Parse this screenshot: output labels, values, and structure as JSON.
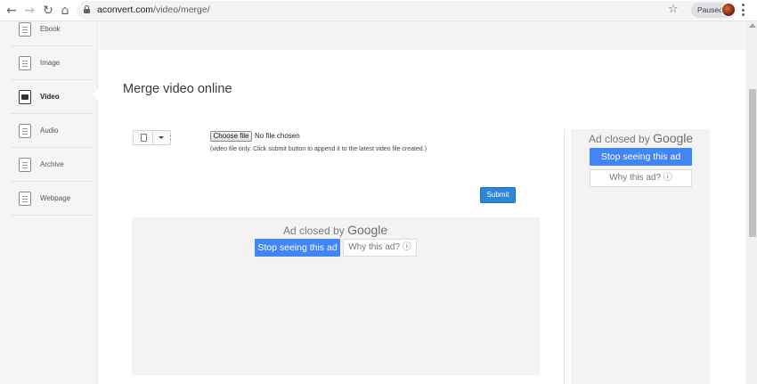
{
  "browser": {
    "url_domain": "aconvert.com",
    "url_path": "/video/merge/",
    "profile_status": "Paused",
    "icons": [
      "back-arrow-icon",
      "forward-arrow-icon",
      "reload-icon",
      "home-icon",
      "lock-icon",
      "star-icon",
      "menu-dots-icon"
    ]
  },
  "sidebar": {
    "items": [
      {
        "label": "Ebook",
        "icon": "ebook-icon"
      },
      {
        "label": "Image",
        "icon": "image-icon"
      },
      {
        "label": "Video",
        "icon": "video-icon",
        "active": true
      },
      {
        "label": "Audio",
        "icon": "audio-icon"
      },
      {
        "label": "Archive",
        "icon": "archive-icon"
      },
      {
        "label": "Webpage",
        "icon": "webpage-icon"
      }
    ]
  },
  "main": {
    "title": "Merge video online",
    "choose_file_label": "Choose file",
    "no_file_text": "No file chosen",
    "hint": "(video file only. Click submit button to append it to the latest video file created.)",
    "submit_label": "Submit",
    "colon": ":"
  },
  "ads": {
    "closed_prefix": "Ad closed by",
    "closed_brand": "Google",
    "stop_label": "Stop seeing this ad",
    "why_label": "Why this ad? ⓘ"
  },
  "colors": {
    "accent_blue": "#2e86d9",
    "google_blue": "#4285f4"
  }
}
